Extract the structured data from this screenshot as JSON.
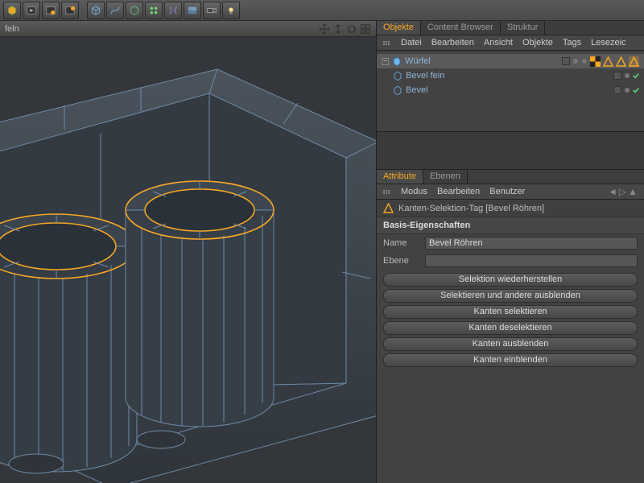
{
  "viewport": {
    "header_left": "feln"
  },
  "panels": {
    "objects": {
      "tabs": [
        "Objekte",
        "Content Browser",
        "Struktur"
      ],
      "active_tab": 0,
      "menu": [
        "Datei",
        "Bearbeiten",
        "Ansicht",
        "Objekte",
        "Tags",
        "Lesezeic"
      ]
    },
    "attributes": {
      "tabs": [
        "Attribute",
        "Ebenen"
      ],
      "active_tab": 0,
      "menu": [
        "Modus",
        "Bearbeiten",
        "Benutzer"
      ],
      "title": "Kanten-Selektion-Tag [Bevel Röhren]",
      "section": "Basis-Eigenschaften",
      "fields": {
        "name_label": "Name",
        "name_value": "Bevel Röhren",
        "layer_label": "Ebene",
        "layer_value": ""
      },
      "buttons": [
        "Selektion wiederherstellen",
        "Selektieren und andere ausblenden",
        "Kanten selektieren",
        "Kanten deselektieren",
        "Kanten ausblenden",
        "Kanten einblenden"
      ]
    }
  },
  "tree": {
    "root": {
      "label": "Würfel"
    },
    "children": [
      {
        "label": "Bevel fein"
      },
      {
        "label": "Bevel"
      }
    ]
  }
}
